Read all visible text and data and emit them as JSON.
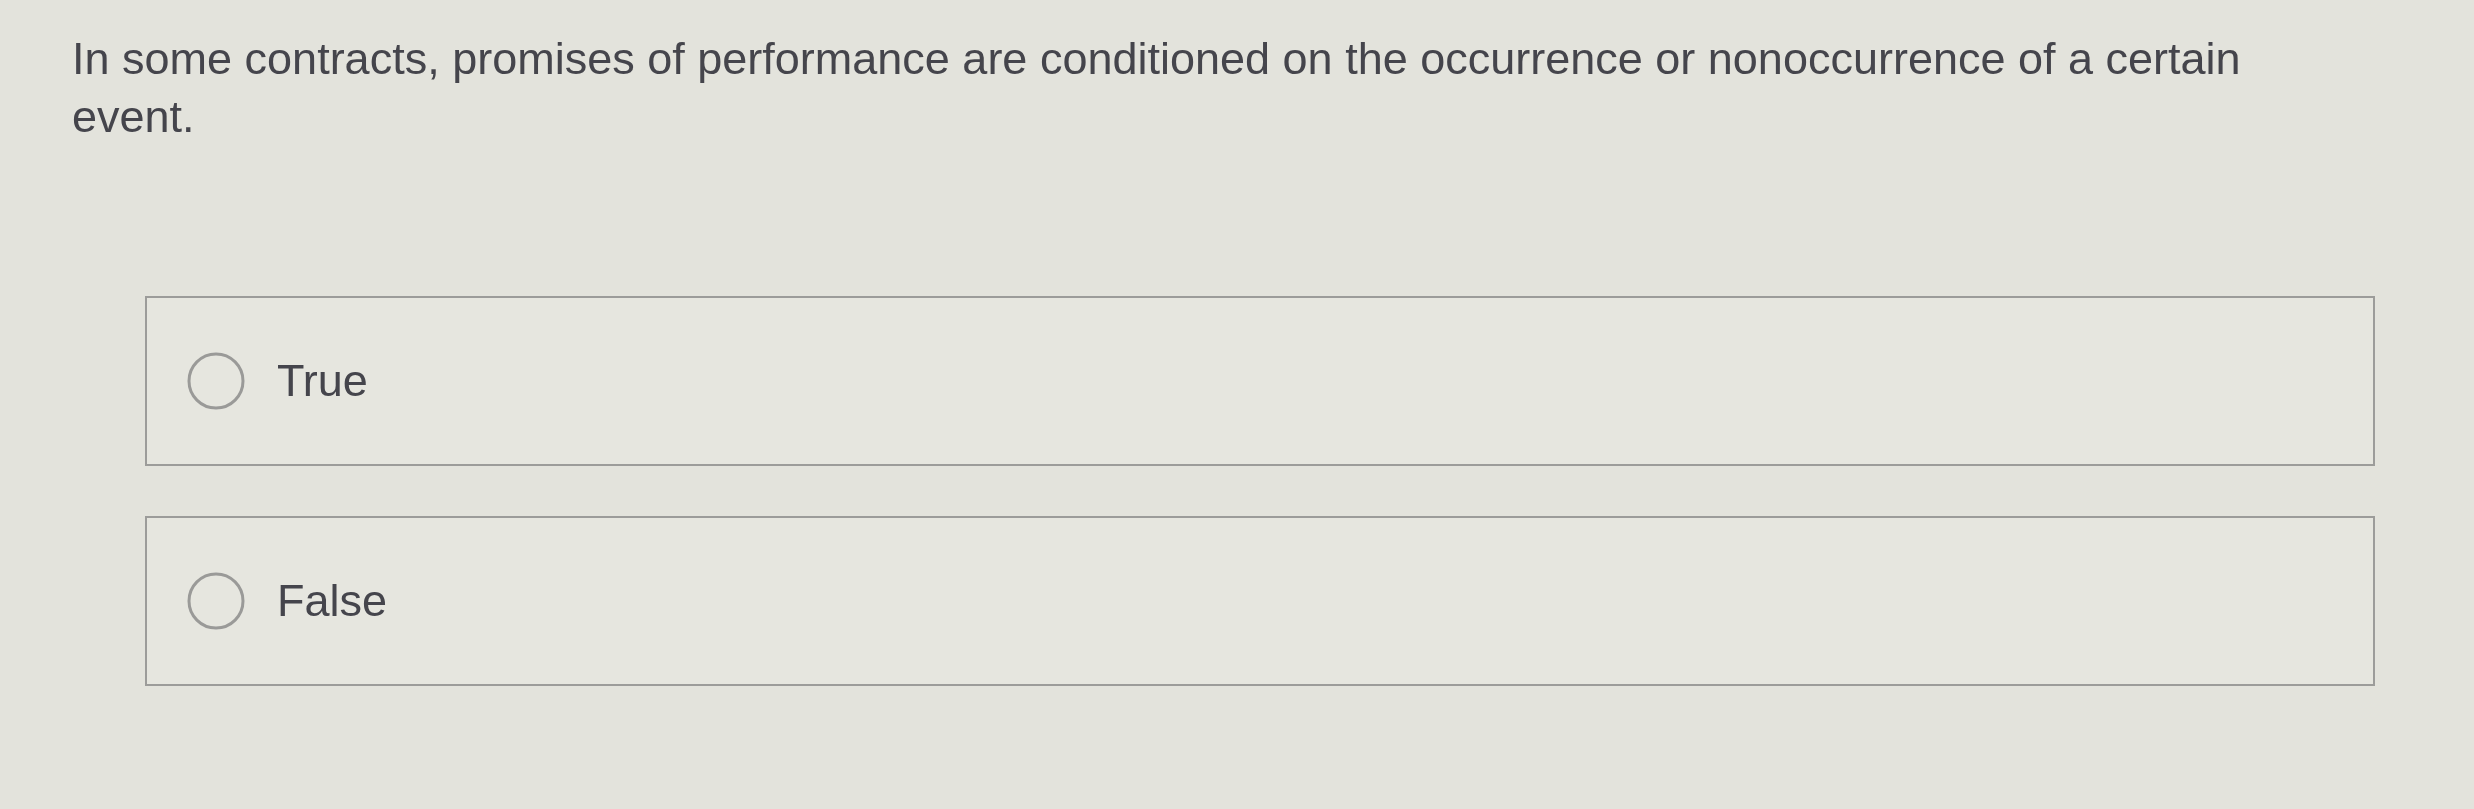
{
  "question": {
    "text": "In some contracts, promises of performance are conditioned on the occurrence or nonoccurrence of a certain event."
  },
  "options": [
    {
      "label": "True",
      "selected": false
    },
    {
      "label": "False",
      "selected": false
    }
  ]
}
